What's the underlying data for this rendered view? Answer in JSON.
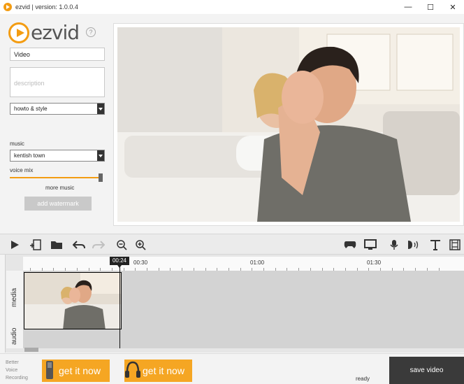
{
  "window": {
    "title": "ezvid | version: 1.0.0.4",
    "minimize_glyph": "—",
    "maximize_glyph": "☐",
    "close_glyph": "✕"
  },
  "logo": {
    "text": "ezvid",
    "help_glyph": "?"
  },
  "form": {
    "title_value": "Video",
    "description_placeholder": "description",
    "category_value": "howto & style",
    "music_label": "music",
    "music_value": "kentish town",
    "voice_mix_label": "voice mix",
    "voice_mix_level": 0.97,
    "more_music_label": "more music",
    "add_watermark_label": "add watermark"
  },
  "timeline": {
    "playhead_time": "00:24",
    "ticks": [
      "00:30",
      "01:00",
      "01:30"
    ],
    "track_media_label": "media",
    "track_audio_label": "audio"
  },
  "bottom": {
    "promo_line1": "Better",
    "promo_line2": "Voice",
    "promo_line3": "Recording",
    "get_it_now_1": "get it now",
    "get_it_now_2": "get it now",
    "status": "ready",
    "save_video_label": "save video"
  },
  "colors": {
    "accent": "#f39c12",
    "promo": "#f5a623",
    "save_button": "#3a3a3a"
  }
}
